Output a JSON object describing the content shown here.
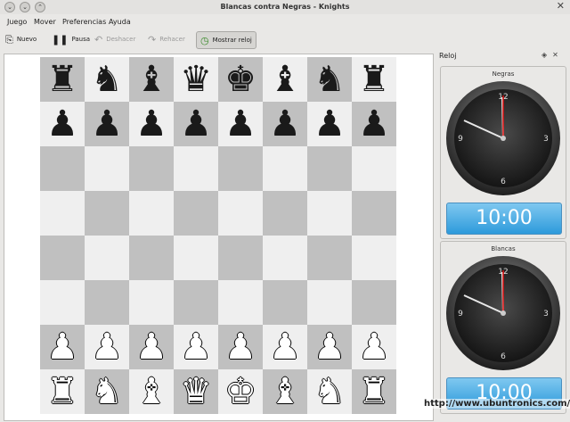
{
  "window": {
    "title": "Blancas contra Negras - Knights"
  },
  "menu": [
    "Juego",
    "Mover",
    "Preferencias",
    "Ayuda"
  ],
  "toolbar": {
    "nuevo": "Nuevo",
    "pausa": "Pausa",
    "deshacer": "Deshacer",
    "rehacer": "Rehacer",
    "mostrar_reloj": "Mostrar reloj"
  },
  "board": {
    "ranks": [
      [
        "br",
        "bn",
        "bb",
        "bq",
        "bk",
        "bb",
        "bn",
        "br"
      ],
      [
        "bp",
        "bp",
        "bp",
        "bp",
        "bp",
        "bp",
        "bp",
        "bp"
      ],
      [
        "",
        "",
        "",
        "",
        "",
        "",
        "",
        ""
      ],
      [
        "",
        "",
        "",
        "",
        "",
        "",
        "",
        ""
      ],
      [
        "",
        "",
        "",
        "",
        "",
        "",
        "",
        ""
      ],
      [
        "",
        "",
        "",
        "",
        "",
        "",
        "",
        ""
      ],
      [
        "wp",
        "wp",
        "wp",
        "wp",
        "wp",
        "wp",
        "wp",
        "wp"
      ],
      [
        "wr",
        "wn",
        "wb",
        "wq",
        "wk",
        "wb",
        "wn",
        "wr"
      ]
    ]
  },
  "clock_panel": {
    "title": "Reloj",
    "clocks": [
      {
        "player": "Negras",
        "time": "10:00",
        "numerals": [
          "12",
          "3",
          "6",
          "9"
        ]
      },
      {
        "player": "Blancas",
        "time": "10:00",
        "numerals": [
          "12",
          "3",
          "6",
          "9"
        ]
      }
    ]
  },
  "watermark": "http://www.ubuntronics.com/"
}
